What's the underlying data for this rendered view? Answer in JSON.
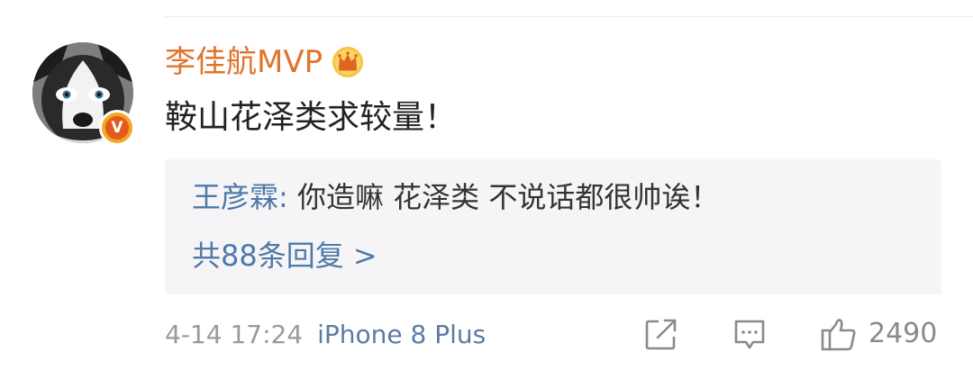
{
  "comment": {
    "username": "李佳航MVP",
    "verified_badge_letter": "V",
    "text": "鞍山花泽类求较量！",
    "reply": {
      "author": "王彦霖",
      "separator": ": ",
      "text": "你造嘛 花泽类 不说话都很帅诶！",
      "more_label": "共88条回复 >"
    },
    "meta": {
      "time": "4-14 17:24",
      "device": "iPhone 8 Plus"
    },
    "actions": {
      "like_count": "2490"
    }
  },
  "colors": {
    "username": "#e1742b",
    "link": "#4f79a8",
    "meta": "#9a9a9a",
    "reply_bg": "#f5f5f7",
    "badge": "#e35a1e"
  },
  "icons": {
    "crown": "crown-icon",
    "verified": "verified-v-icon",
    "share": "share-icon",
    "comment": "comment-icon",
    "like": "thumbs-up-icon"
  }
}
